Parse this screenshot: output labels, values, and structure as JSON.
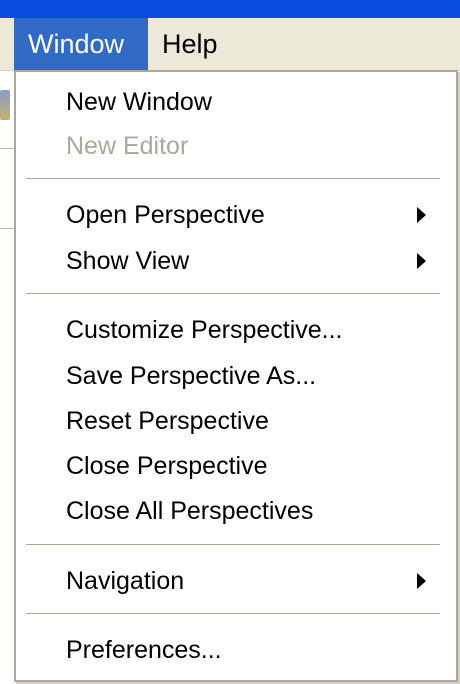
{
  "menubar": {
    "items": [
      {
        "label": "Window",
        "active": true
      },
      {
        "label": "Help",
        "active": false
      }
    ]
  },
  "menu": {
    "groups": [
      [
        {
          "label": "New Window",
          "enabled": true,
          "submenu": false
        },
        {
          "label": "New Editor",
          "enabled": false,
          "submenu": false
        }
      ],
      [
        {
          "label": "Open Perspective",
          "enabled": true,
          "submenu": true
        },
        {
          "label": "Show View",
          "enabled": true,
          "submenu": true
        }
      ],
      [
        {
          "label": "Customize Perspective...",
          "enabled": true,
          "submenu": false
        },
        {
          "label": "Save Perspective As...",
          "enabled": true,
          "submenu": false
        },
        {
          "label": "Reset Perspective",
          "enabled": true,
          "submenu": false
        },
        {
          "label": "Close Perspective",
          "enabled": true,
          "submenu": false
        },
        {
          "label": "Close All Perspectives",
          "enabled": true,
          "submenu": false
        }
      ],
      [
        {
          "label": "Navigation",
          "enabled": true,
          "submenu": true
        }
      ],
      [
        {
          "label": "Preferences...",
          "enabled": true,
          "submenu": false
        }
      ]
    ]
  },
  "colors": {
    "title_bar": "#0a4ee0",
    "menubar_bg": "#ece9d8",
    "highlight": "#316ac5",
    "disabled_text": "#aca899",
    "menu_border": "#aca899"
  }
}
